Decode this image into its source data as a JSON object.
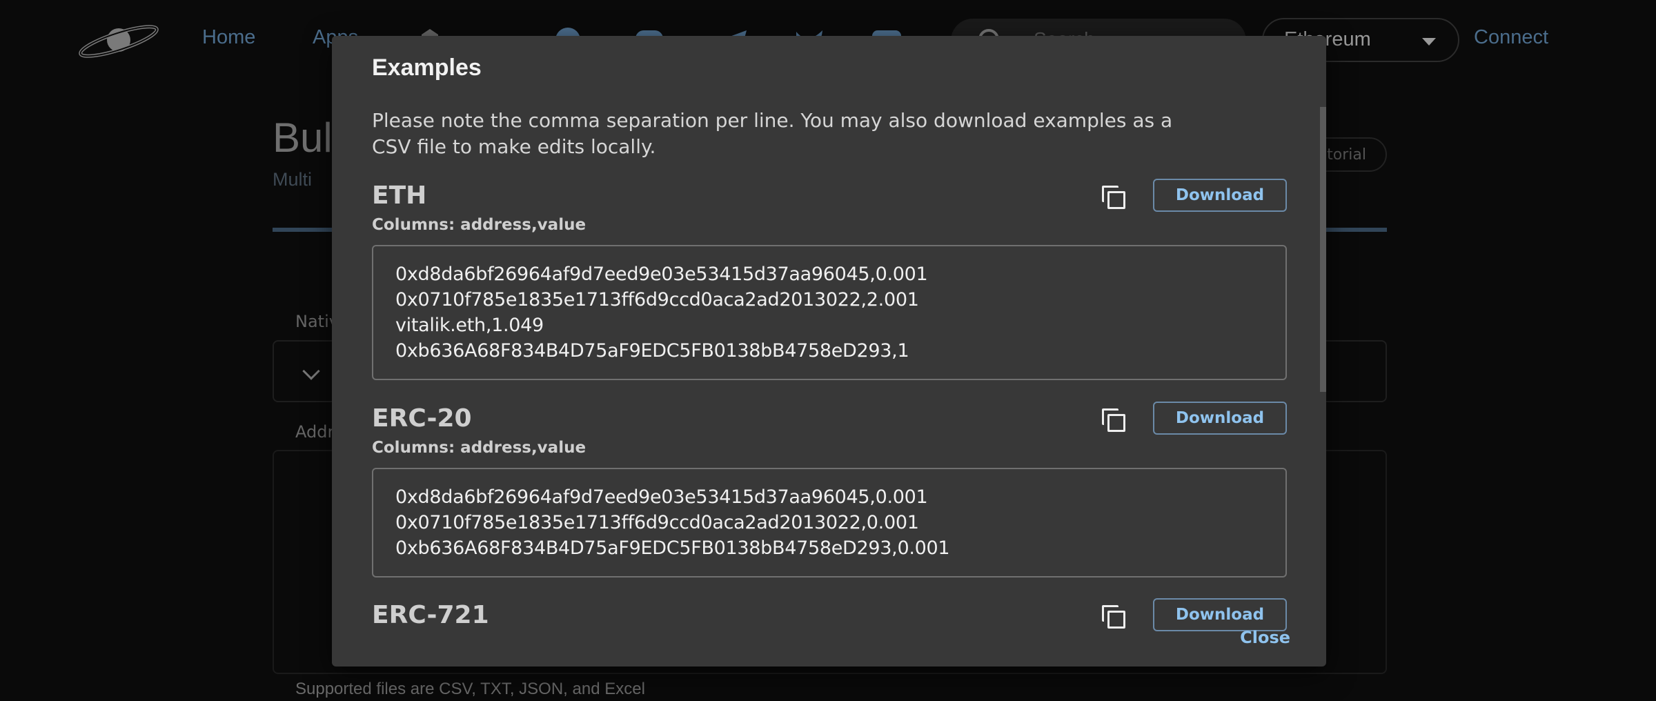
{
  "header": {
    "nav": [
      "Home",
      "Apps"
    ],
    "search_placeholder": "Search",
    "network": "Ethereum",
    "connect_label": "Connect",
    "social_icons": [
      "github-icon",
      "discord-icon",
      "telegram-icon",
      "twitter-icon",
      "youtube-icon"
    ]
  },
  "background": {
    "title": "Bulk Transfer",
    "subtitle": "Multi",
    "tutorial_label": "Tutorial",
    "type_label": "Native",
    "addresses_label": "Addresses",
    "help_text": "Supported files are CSV, TXT, JSON, and Excel"
  },
  "modal": {
    "title": "Examples",
    "description": "Please note the comma separation per line. You may also download examples as a CSV file to make edits locally.",
    "sections": [
      {
        "heading": "ETH",
        "columns": "Columns: address,value",
        "download_label": "Download",
        "rows": [
          "0xd8da6bf26964af9d7eed9e03e53415d37aa96045,0.001",
          "0x0710f785e1835e1713ff6d9ccd0aca2ad2013022,2.001",
          "vitalik.eth,1.049",
          "0xb636A68F834B4D75aF9EDC5FB0138bB4758eD293,1"
        ]
      },
      {
        "heading": "ERC-20",
        "columns": "Columns: address,value",
        "download_label": "Download",
        "rows": [
          "0xd8da6bf26964af9d7eed9e03e53415d37aa96045,0.001",
          "0x0710f785e1835e1713ff6d9ccd0aca2ad2013022,0.001",
          "0xb636A68F834B4D75aF9EDC5FB0138bB4758eD293,0.001"
        ]
      },
      {
        "heading": "ERC-721",
        "columns": "",
        "download_label": "Download",
        "rows": []
      }
    ],
    "close_label": "Close"
  }
}
